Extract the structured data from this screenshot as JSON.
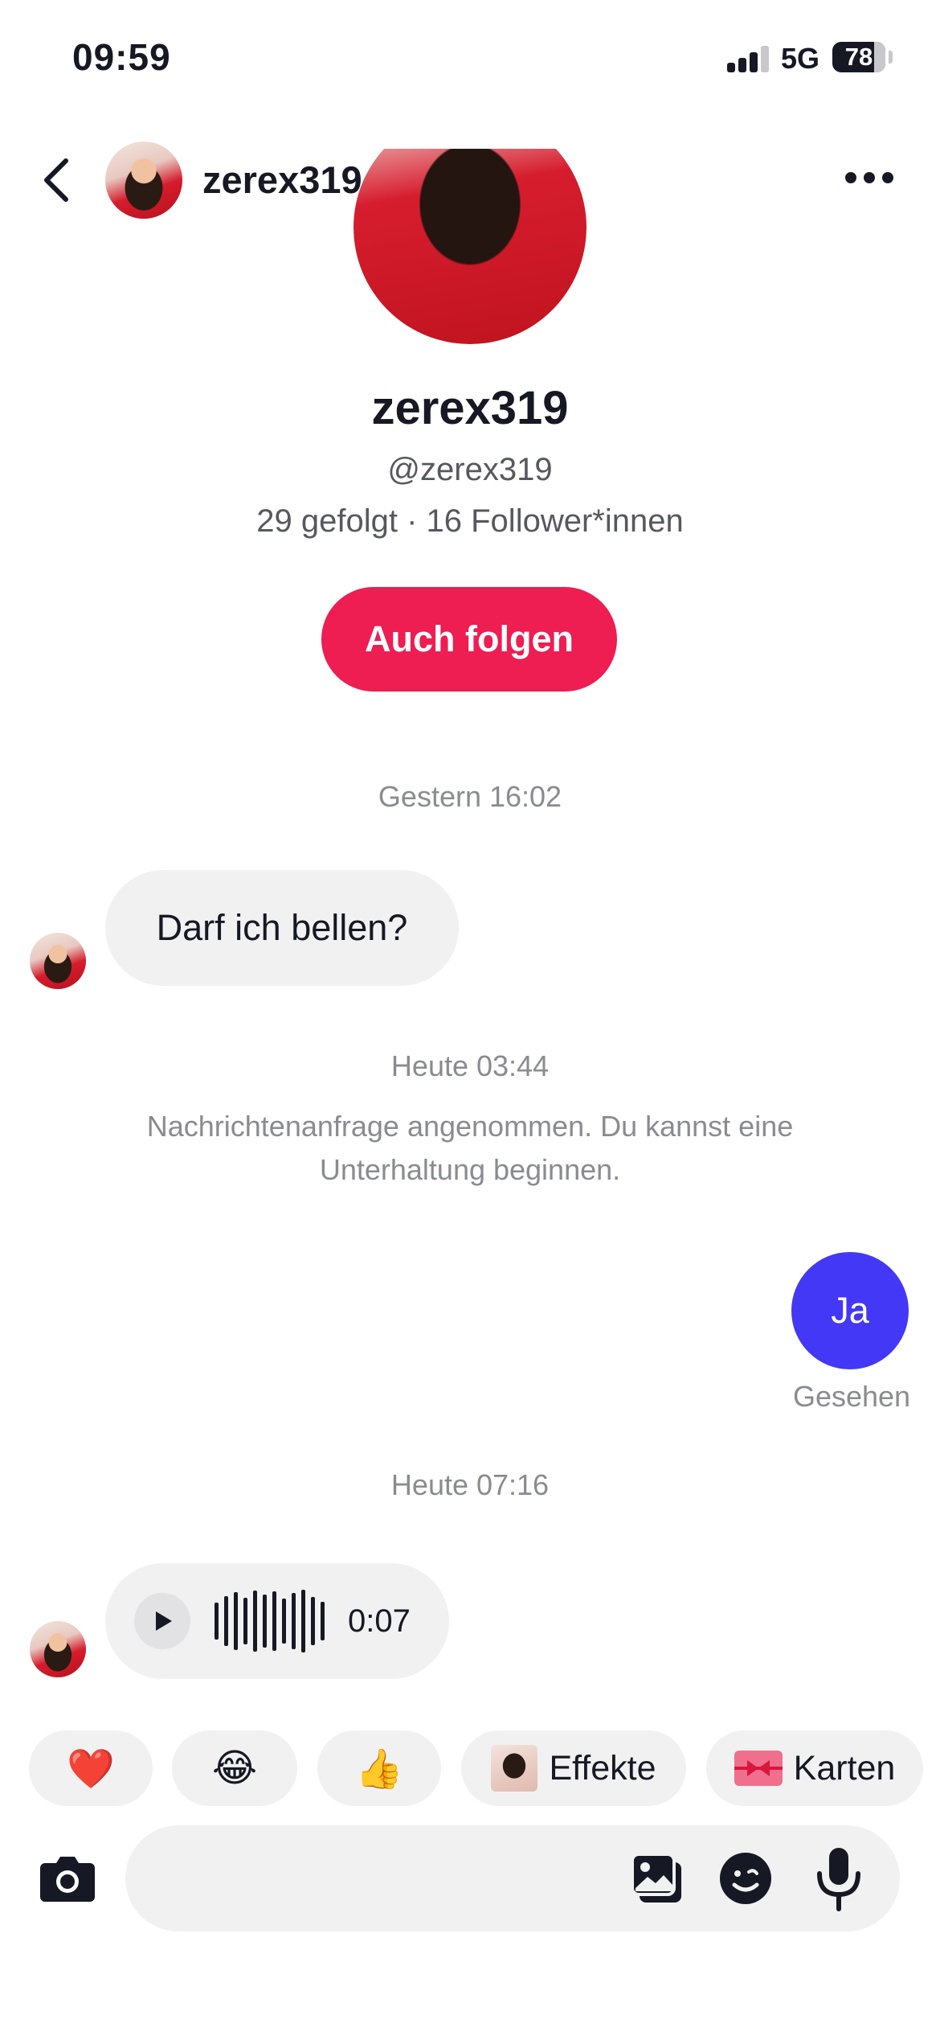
{
  "status_bar": {
    "time": "09:59",
    "network": "5G",
    "battery": "78"
  },
  "header": {
    "username": "zerex319"
  },
  "profile": {
    "name": "zerex319",
    "handle": "@zerex319",
    "stats": "29 gefolgt · 16 Follower*innen",
    "follow_button": "Auch folgen"
  },
  "messages": [
    {
      "timestamp": "Gestern 16:02",
      "text": "Darf ich bellen?"
    },
    {
      "timestamp": "Heute 03:44",
      "system": "Nachrichtenanfrage angenommen. Du kannst eine Unterhaltung beginnen.",
      "outgoing": "Ja",
      "status": "Gesehen"
    },
    {
      "timestamp": "Heute 07:16",
      "voice_duration": "0:07"
    }
  ],
  "quick_replies": [
    {
      "emoji": "❤️"
    },
    {
      "emoji": "😂"
    },
    {
      "emoji": "👍"
    },
    {
      "label": "Effekte"
    },
    {
      "label": "Karten"
    }
  ],
  "colors": {
    "accent": "#ee1d52",
    "outgoing_bubble": "#4338f5",
    "bubble_in": "#f1f1f2",
    "muted_text": "#8a8b91"
  },
  "icons": [
    "back-icon",
    "more-icon",
    "play-icon",
    "camera-icon",
    "gallery-icon",
    "emoji-icon",
    "mic-icon"
  ]
}
